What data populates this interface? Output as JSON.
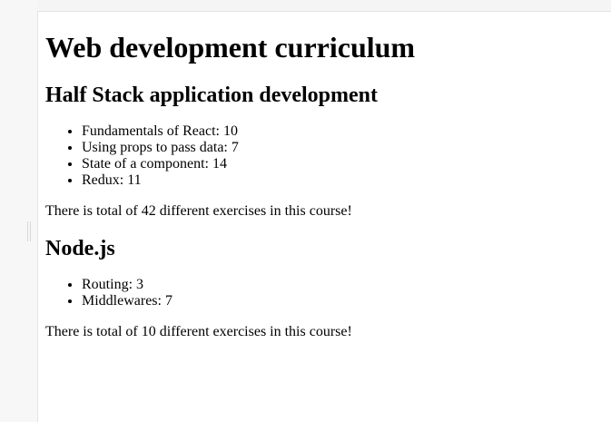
{
  "title": "Web development curriculum",
  "courses": [
    {
      "name": "Half Stack application development",
      "parts": [
        "Fundamentals of React: 10",
        "Using props to pass data: 7",
        "State of a component: 14",
        "Redux: 11"
      ],
      "total_text": "There is total of 42 different exercises in this course!"
    },
    {
      "name": "Node.js",
      "parts": [
        "Routing: 3",
        "Middlewares: 7"
      ],
      "total_text": "There is total of 10 different exercises in this course!"
    }
  ]
}
